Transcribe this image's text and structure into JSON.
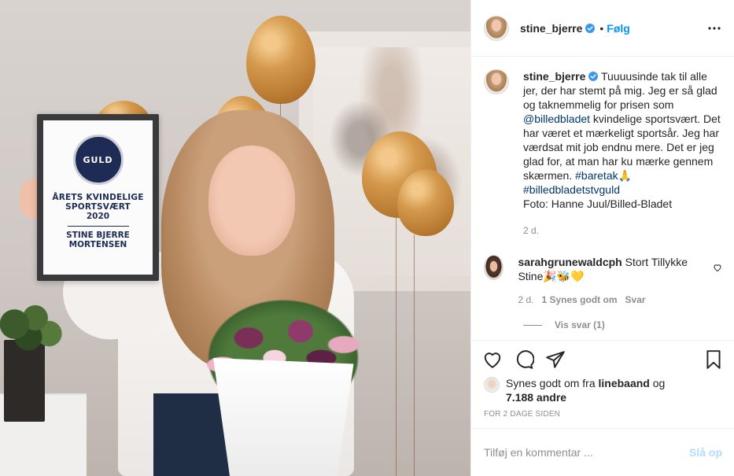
{
  "post": {
    "author": "stine_bjerre",
    "verified": true,
    "follow_label": "Følg",
    "separator": "•"
  },
  "award": {
    "badge": "GULD",
    "title_line1": "ÅRETS KVINDELIGE",
    "title_line2": "SPORTSVÆRT",
    "year": "2020",
    "name_line1": "STINE BJERRE",
    "name_line2": "MORTENSEN"
  },
  "caption": {
    "username": "stine_bjerre",
    "text1": " Tuuuusinde tak til alle jer, der har stemt på mig. Jeg er så glad og taknemmelig for prisen som ",
    "mention": "@billedbladet",
    "text2": " kvindelige sportsvært. Det har været et mærkeligt sportsår. Jeg har værdsat mit job endnu mere. Det er jeg glad for, at man har ku mærke gennem skærmen. ",
    "hashtag1": "#baretak",
    "emoji1": "🙏",
    "hashtag2": "#billedbladetstvguld",
    "photo_credit": "Foto: Hanne Juul/Billed-Bladet",
    "time": "2 d."
  },
  "comment": {
    "username": "sarahgrunewaldcph",
    "text": " Stort Tillykke Stine",
    "emojis": "🎉🐝💛",
    "time": "2 d.",
    "likes": "1 Synes godt om",
    "reply": "Svar",
    "view_replies": "Vis svar (1)"
  },
  "likes": {
    "prefix": "Synes godt om fra ",
    "user": "linebaand",
    "mid": " og",
    "count": "7.188 andre"
  },
  "timestamp": "FOR 2 DAGE SIDEN",
  "add_comment": {
    "placeholder": "Tilføj en kommentar ...",
    "post_label": "Slå op"
  },
  "colors": {
    "link": "#00376b",
    "accent": "#0095f6",
    "muted": "#8e8e8e",
    "post_disabled": "#b3dbff"
  }
}
